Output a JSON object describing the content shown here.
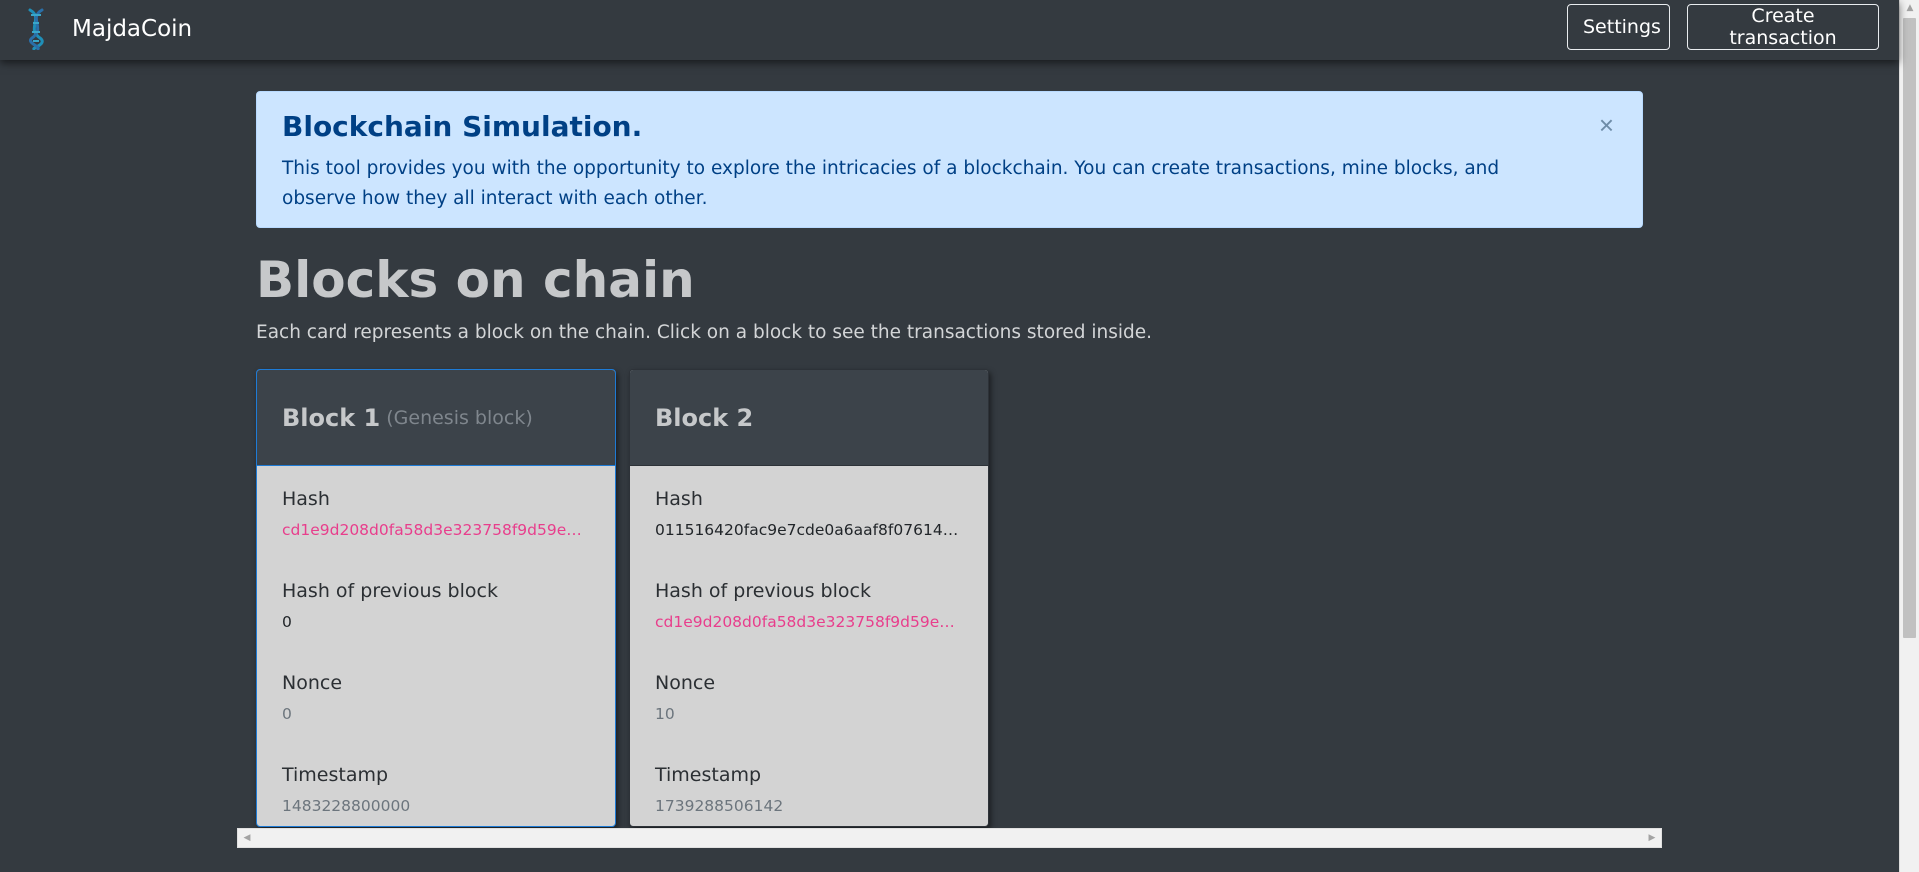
{
  "navbar": {
    "brand_icon": "dna-icon",
    "brand_name": "MajdaCoin",
    "settings_label": "Settings",
    "create_transaction_label": "Create transaction"
  },
  "alert": {
    "title": "Blockchain Simulation.",
    "text": "This tool provides you with the opportunity to explore the intricacies of a blockchain. You can create transactions, mine blocks, and observe how they all interact with each other.",
    "close_symbol": "×"
  },
  "page": {
    "title": "Blocks on chain",
    "subtitle": "Each card represents a block on the chain. Click on a block to see the transactions stored inside."
  },
  "blocks": [
    {
      "title": "Block 1",
      "subtitle": "(Genesis block)",
      "hash_label": "Hash",
      "hash": "cd1e9d208d0fa58d3e323758f9d59ed4fdc…",
      "prev_hash_label": "Hash of previous block",
      "prev_hash": "0",
      "nonce_label": "Nonce",
      "nonce": "0",
      "timestamp_label": "Timestamp",
      "timestamp": "1483228800000"
    },
    {
      "title": "Block 2",
      "subtitle": "",
      "hash_label": "Hash",
      "hash": "011516420fac9e7cde0a6aaf8f076142294f…",
      "prev_hash_label": "Hash of previous block",
      "prev_hash": "cd1e9d208d0fa58d3e323758f9d59ed4fdc…",
      "nonce_label": "Nonce",
      "nonce": "10",
      "timestamp_label": "Timestamp",
      "timestamp": "1739288506142"
    }
  ],
  "colors": {
    "background": "#343a40",
    "alert_bg": "#cce5ff",
    "alert_text": "#004085",
    "valid_hash": "#e83e8c",
    "active_border": "#1e7bd6"
  }
}
